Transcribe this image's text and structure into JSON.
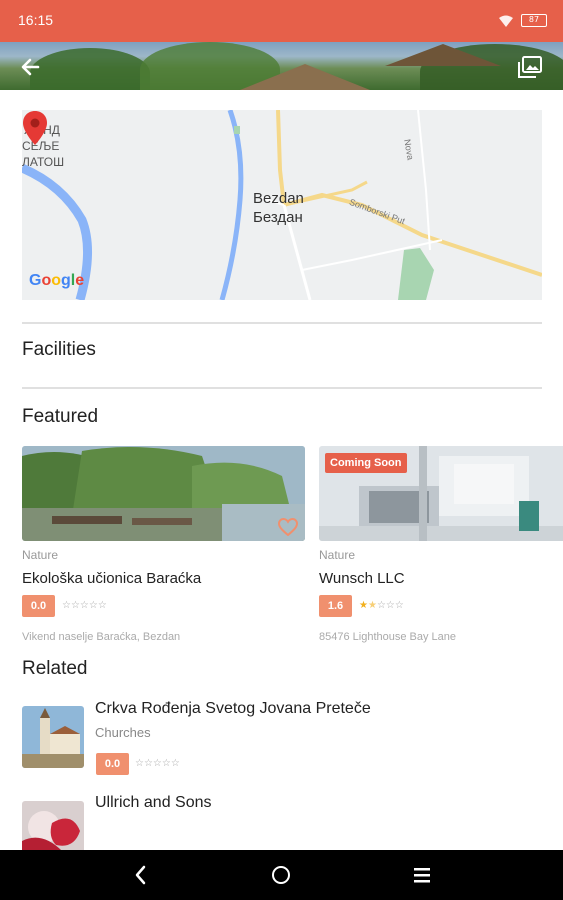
{
  "status_bar": {
    "time": "16:15",
    "battery": "87",
    "wifi_icon": "wifi-icon",
    "battery_icon": "battery-icon"
  },
  "hero": {
    "back_icon": "arrow-left-icon",
    "gallery_icon": "gallery-icon"
  },
  "map": {
    "city_latin": "Bezdan",
    "city_cyrillic": "Бездан",
    "area_labels": [
      "ЖЕНД",
      "СЕЉЕ",
      "ЛАТОШ"
    ],
    "road_label_1": "Nova",
    "road_label_2": "Somborski Put",
    "google_logo": [
      "G",
      "o",
      "o",
      "g",
      "l",
      "e"
    ],
    "google_colors": [
      "#4285F4",
      "#EA4335",
      "#FBBC05",
      "#4285F4",
      "#34A853",
      "#EA4335"
    ],
    "pin_icon": "map-pin-icon",
    "pin_color": "#E53935"
  },
  "sections": {
    "facilities": "Facilities",
    "featured": "Featured",
    "related": "Related"
  },
  "featured": [
    {
      "category": "Nature",
      "title": "Ekološka učionica Baraćka",
      "rating": "0.0",
      "stars": "☆☆☆☆☆",
      "address": "Vikend naselje Baraćka, Bezdan",
      "favorite_icon": "heart-outline-icon"
    },
    {
      "category": "Nature",
      "title": "Wunsch LLC",
      "rating": "1.6",
      "stars_filled": "★",
      "stars_half": "★",
      "stars_empty": "☆☆☆",
      "address": "85476 Lighthouse Bay Lane",
      "badge": "Coming Soon"
    }
  ],
  "related": [
    {
      "title": "Crkva Rođenja Svetog Jovana Preteče",
      "category": "Churches",
      "rating": "0.0",
      "stars": "☆☆☆☆☆"
    },
    {
      "title": "Ullrich and Sons"
    }
  ],
  "nav": {
    "back_icon": "nav-back-icon",
    "home_icon": "nav-home-icon",
    "menu_icon": "nav-menu-icon"
  },
  "colors": {
    "accent": "#E6604A",
    "rating_badge": "#F0906E",
    "star_filled": "#F2B01E"
  }
}
